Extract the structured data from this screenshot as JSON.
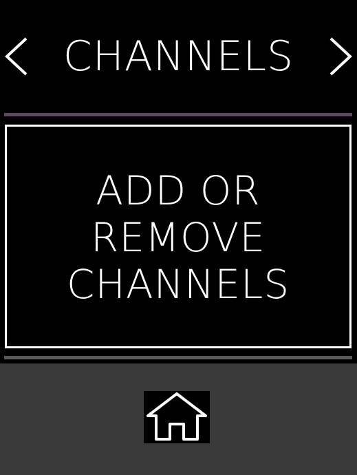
{
  "header": {
    "title": "CHANNELS",
    "prev_icon": "chevron-left-icon",
    "next_icon": "chevron-right-icon"
  },
  "main": {
    "card_lines": [
      "ADD OR",
      "REMOVE",
      "CHANNELS"
    ]
  },
  "footer": {
    "home_icon": "home-icon"
  },
  "colors": {
    "background": "#000000",
    "foreground": "#ffffff",
    "divider_top": "#5b4a5e",
    "divider_bottom": "#5a5a5a",
    "dot_grid": "#3a3a3a"
  }
}
